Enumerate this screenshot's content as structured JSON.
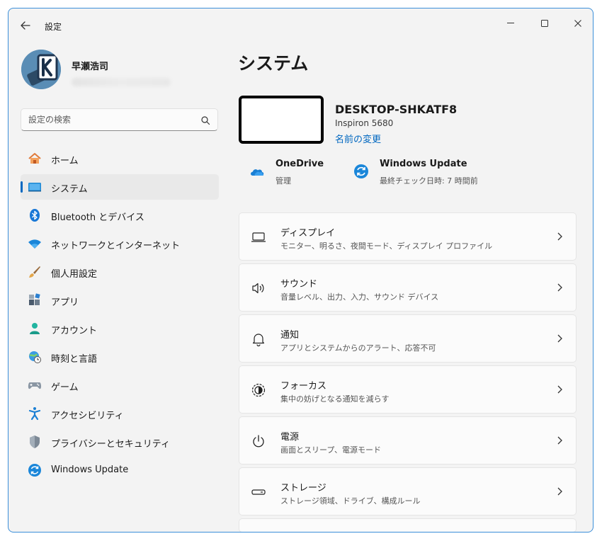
{
  "window": {
    "title": "設定"
  },
  "profile": {
    "name": "早瀬浩司"
  },
  "search": {
    "placeholder": "設定の検索"
  },
  "nav": [
    {
      "label": "ホーム",
      "icon": "home-icon"
    },
    {
      "label": "システム",
      "icon": "system-icon",
      "active": true
    },
    {
      "label": "Bluetooth とデバイス",
      "icon": "bluetooth-icon"
    },
    {
      "label": "ネットワークとインターネット",
      "icon": "wifi-icon"
    },
    {
      "label": "個人用設定",
      "icon": "brush-icon"
    },
    {
      "label": "アプリ",
      "icon": "apps-icon"
    },
    {
      "label": "アカウント",
      "icon": "account-icon"
    },
    {
      "label": "時刻と言語",
      "icon": "time-language-icon"
    },
    {
      "label": "ゲーム",
      "icon": "gamepad-icon"
    },
    {
      "label": "アクセシビリティ",
      "icon": "accessibility-icon"
    },
    {
      "label": "プライバシーとセキュリティ",
      "icon": "shield-icon"
    },
    {
      "label": "Windows Update",
      "icon": "windows-update-icon"
    }
  ],
  "main": {
    "title": "システム",
    "device": {
      "name": "DESKTOP-SHKATF8",
      "model": "Inspiron 5680",
      "rename_link": "名前の変更"
    },
    "quick": {
      "onedrive": {
        "title": "OneDrive",
        "sub": "管理"
      },
      "windows_update": {
        "title": "Windows Update",
        "sub": "最終チェック日時: 7 時間前"
      }
    },
    "cards": [
      {
        "title": "ディスプレイ",
        "sub": "モニター、明るさ、夜間モード、ディスプレイ プロファイル",
        "icon": "display-icon"
      },
      {
        "title": "サウンド",
        "sub": "音量レベル、出力、入力、サウンド デバイス",
        "icon": "speaker-icon"
      },
      {
        "title": "通知",
        "sub": "アプリとシステムからのアラート、応答不可",
        "icon": "bell-icon"
      },
      {
        "title": "フォーカス",
        "sub": "集中の妨げとなる通知を減らす",
        "icon": "focus-icon"
      },
      {
        "title": "電源",
        "sub": "画面とスリープ、電源モード",
        "icon": "power-icon"
      },
      {
        "title": "ストレージ",
        "sub": "ストレージ領域、ドライブ、構成ルール",
        "icon": "storage-icon"
      }
    ]
  },
  "colors": {
    "accent": "#0067c0",
    "window_bg": "#f3f3f3",
    "card_bg": "#fbfbfb",
    "border": "#3b8fd9"
  }
}
